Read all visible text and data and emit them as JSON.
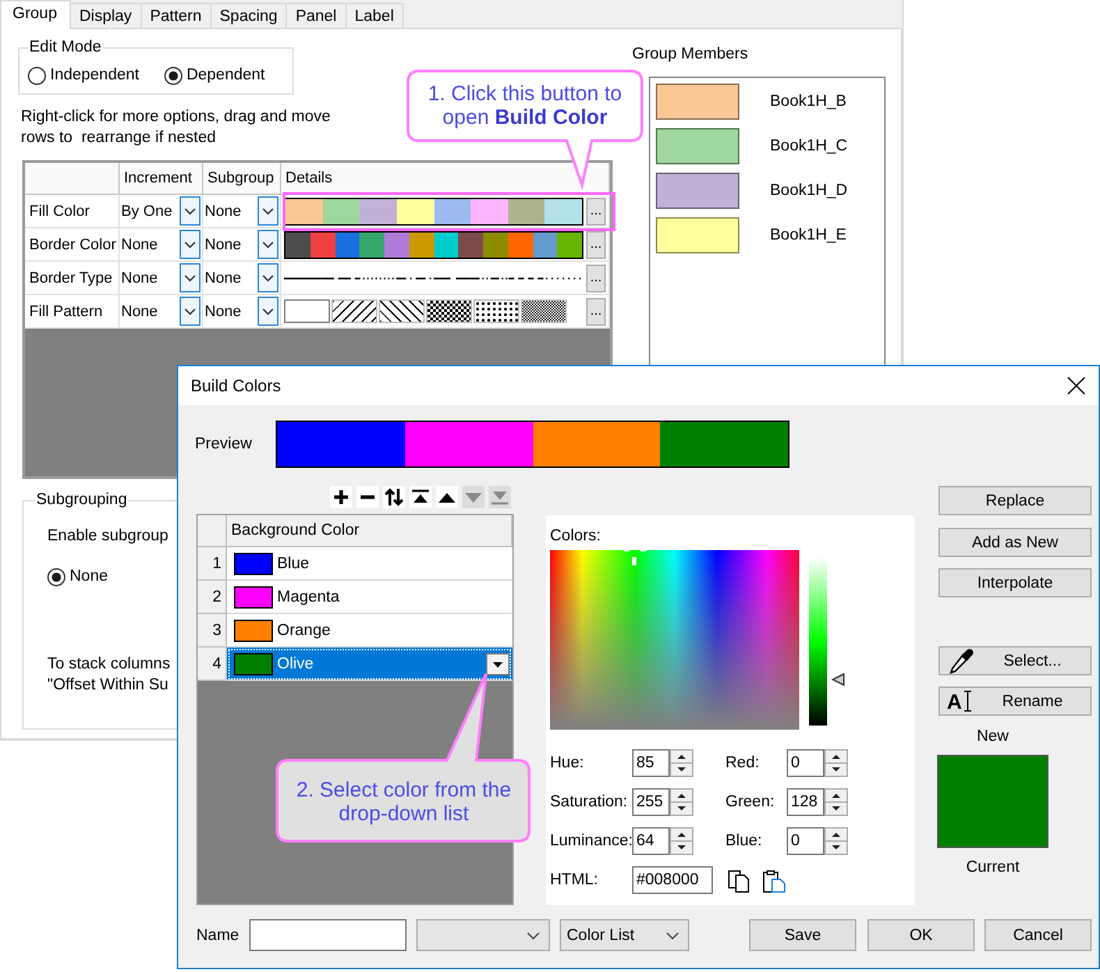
{
  "main_window": {
    "tabs": [
      {
        "label": "Group",
        "selected": true
      },
      {
        "label": "Display",
        "selected": false
      },
      {
        "label": "Pattern",
        "selected": false
      },
      {
        "label": "Spacing",
        "selected": false
      },
      {
        "label": "Panel",
        "selected": false
      },
      {
        "label": "Label",
        "selected": false
      }
    ],
    "edit_mode": {
      "title": "Edit Mode",
      "options": [
        {
          "label": "Independent",
          "selected": false
        },
        {
          "label": "Dependent",
          "selected": true
        }
      ]
    },
    "hint": "Right-click for more options, drag and move\nrows to  rearrange if nested",
    "table": {
      "columns": [
        "Increment",
        "Subgroup",
        "Details"
      ],
      "rows": [
        {
          "label": "Fill Color",
          "increment": "By One",
          "subgroup": "None",
          "kind": "colors",
          "colors": [
            {
              "color": "#fbc795"
            },
            {
              "color": "#9ed89e"
            },
            {
              "color": "#c2b1d6"
            },
            {
              "color": "#ffff9b"
            },
            {
              "color": "#9dbaf1"
            },
            {
              "color": "#fdb6fd"
            },
            {
              "color": "#adb38e"
            },
            {
              "color": "#b3e2e8"
            }
          ],
          "button": "..."
        },
        {
          "label": "Border Color",
          "increment": "None",
          "subgroup": "None",
          "kind": "colors",
          "colors": [
            {
              "color": "#4d4d4d"
            },
            {
              "color": "#f0403f"
            },
            {
              "color": "#1a6ede"
            },
            {
              "color": "#34a66b"
            },
            {
              "color": "#b07ad8"
            },
            {
              "color": "#cc9a00"
            },
            {
              "color": "#00cccc"
            },
            {
              "color": "#7b4a4a"
            },
            {
              "color": "#8c8c00"
            },
            {
              "color": "#ff6600"
            },
            {
              "color": "#6699cc"
            },
            {
              "color": "#66b400"
            }
          ],
          "button": "..."
        },
        {
          "label": "Border Type",
          "increment": "None",
          "subgroup": "None",
          "kind": "lines",
          "styles": [
            {
              "kind": "solid"
            },
            {
              "kind": "dash"
            },
            {
              "kind": "dot"
            },
            {
              "kind": "dash-dot"
            },
            {
              "kind": "long-dash"
            },
            {
              "kind": "dash-dot-dot"
            },
            {
              "kind": "short-dash"
            },
            {
              "kind": "short-dot"
            }
          ],
          "button": "..."
        },
        {
          "label": "Fill Pattern",
          "increment": "None",
          "subgroup": "None",
          "kind": "patterns",
          "patterns": [
            {
              "kind": "blank"
            },
            {
              "kind": "hatch-up"
            },
            {
              "kind": "hatch-down"
            },
            {
              "kind": "checker"
            },
            {
              "kind": "dots"
            },
            {
              "kind": "fine-checker"
            }
          ],
          "button": "..."
        }
      ]
    },
    "group_members": {
      "title": "Group Members",
      "items": [
        {
          "name": "Book1H_B",
          "color": "#fbc795"
        },
        {
          "name": "Book1H_C",
          "color": "#9ed89e"
        },
        {
          "name": "Book1H_D",
          "color": "#c2b1d6"
        },
        {
          "name": "Book1H_E",
          "color": "#ffff9b"
        }
      ]
    },
    "subgrouping": {
      "title": "Subgrouping",
      "label": "Enable subgroup",
      "options": [
        {
          "label": "None",
          "selected": true
        }
      ],
      "note": "To stack columns\n\"Offset Within Su"
    }
  },
  "build_colors": {
    "title": "Build Colors",
    "preview": {
      "label": "Preview",
      "colors": [
        {
          "color": "#0000ff"
        },
        {
          "color": "#ff00ff"
        },
        {
          "color": "#ff8000"
        },
        {
          "color": "#008000"
        }
      ]
    },
    "toolbar": [
      {
        "kind": "add",
        "disabled": false
      },
      {
        "kind": "remove",
        "disabled": false
      },
      {
        "kind": "sort",
        "disabled": false
      },
      {
        "kind": "top",
        "disabled": false
      },
      {
        "kind": "up",
        "disabled": false
      },
      {
        "kind": "down",
        "disabled": true
      },
      {
        "kind": "bottom",
        "disabled": true
      }
    ],
    "grid": {
      "column": "Background Color",
      "rows": [
        {
          "number": "1",
          "name": "Blue",
          "color": "#0000ff",
          "selected": false
        },
        {
          "number": "2",
          "name": "Magenta",
          "color": "#ff00ff",
          "selected": false
        },
        {
          "number": "3",
          "name": "Orange",
          "color": "#ff8000",
          "selected": false
        },
        {
          "number": "4",
          "name": "Olive",
          "color": "#008000",
          "selected": true
        }
      ]
    },
    "picker": {
      "label": "Colors:",
      "luminance": {
        "level": 0.27
      },
      "fields": [
        {
          "label": "Hue:",
          "value": "85"
        },
        {
          "label": "Red:",
          "value": "0"
        },
        {
          "label": "Saturation:",
          "value": "255"
        },
        {
          "label": "Green:",
          "value": "128"
        },
        {
          "label": "Luminance:",
          "value": "64"
        },
        {
          "label": "Blue:",
          "value": "0"
        }
      ],
      "html": {
        "label": "HTML:",
        "value": "#008000"
      }
    },
    "actions": [
      {
        "label": "Replace"
      },
      {
        "label": "Add as New"
      },
      {
        "label": "Interpolate"
      },
      {
        "label": "Select...",
        "kind": "eyedropper"
      },
      {
        "label": "Rename",
        "kind": "rename",
        "glyph": "A"
      }
    ],
    "swatch": {
      "top_label": "New",
      "color": "#008000",
      "bottom_label": "Current"
    },
    "footer": {
      "name_label": "Name",
      "list_dropdown": {
        "value": "Color List"
      },
      "buttons": [
        "Save",
        "OK",
        "Cancel"
      ]
    }
  },
  "callouts": [
    {
      "text": "1. Click this button to\nopen **Build Color**"
    },
    {
      "text": "2. Select color from the\ndrop-down list"
    }
  ]
}
